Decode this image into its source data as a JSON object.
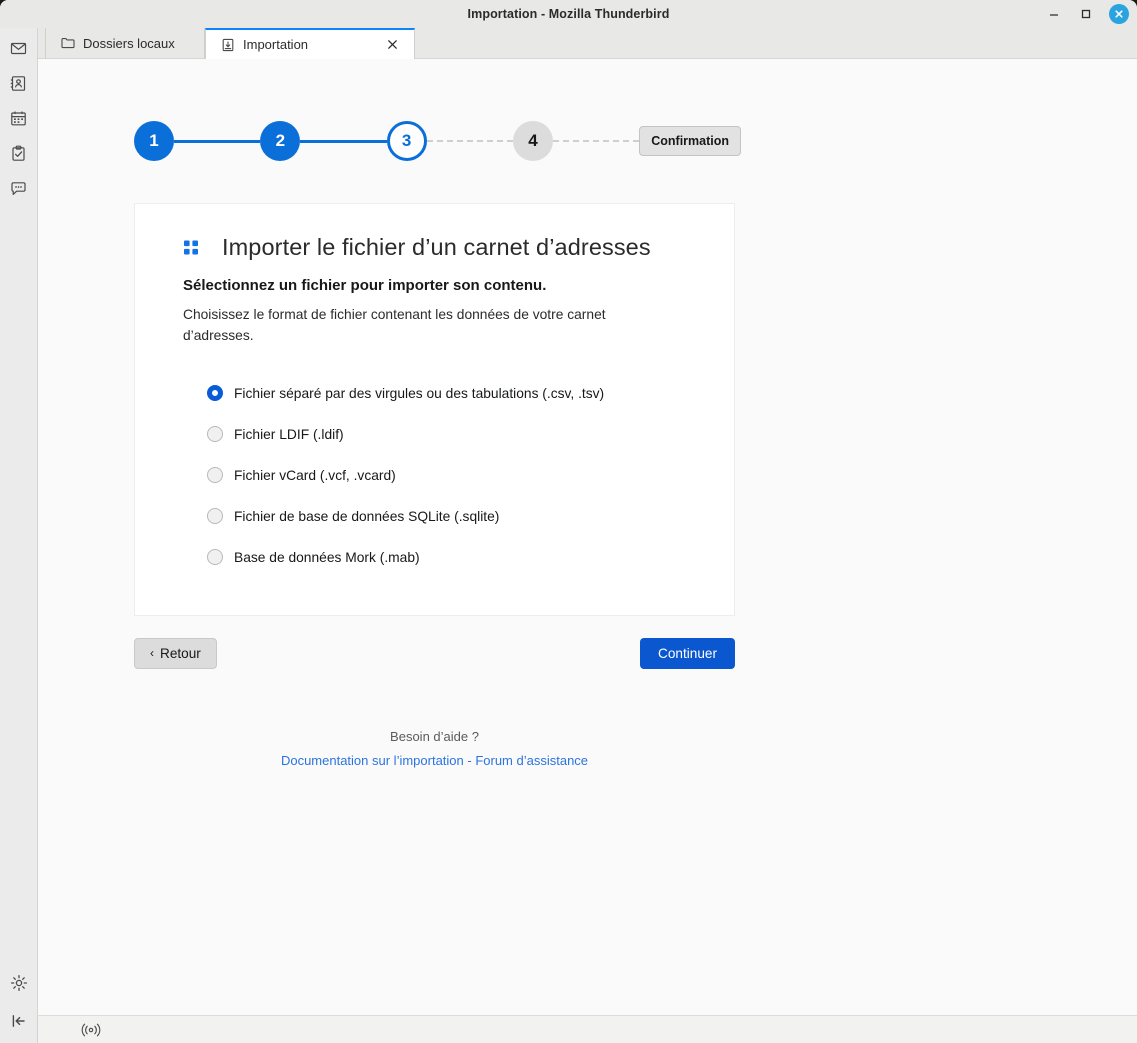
{
  "window": {
    "title": "Importation - Mozilla Thunderbird",
    "controls": {
      "minimize": "minimize-icon",
      "maximize": "maximize-icon",
      "close": "close-icon"
    }
  },
  "rail": {
    "items": [
      {
        "name": "mail-icon",
        "label": "Courrier"
      },
      {
        "name": "address-book-icon",
        "label": "Carnet d’adresses"
      },
      {
        "name": "calendar-icon",
        "label": "Agenda"
      },
      {
        "name": "tasks-icon",
        "label": "Tâches"
      },
      {
        "name": "chat-icon",
        "label": "Discussion"
      }
    ],
    "bottom": [
      {
        "name": "settings-gear-icon",
        "label": "Paramètres"
      },
      {
        "name": "collapse-rail-icon",
        "label": "Réduire"
      }
    ]
  },
  "tabs": [
    {
      "label": "Dossiers locaux",
      "icon": "folder-icon",
      "active": false
    },
    {
      "label": "Importation",
      "icon": "import-icon",
      "active": true,
      "close": "×"
    }
  ],
  "stepper": {
    "steps": [
      {
        "number": "1",
        "state": "done"
      },
      {
        "number": "2",
        "state": "done"
      },
      {
        "number": "3",
        "state": "current"
      },
      {
        "number": "4",
        "state": "todo"
      }
    ],
    "confirmation_label": "Confirmation"
  },
  "card": {
    "icon": "address-book-grid-icon",
    "title": "Importer le fichier d’un carnet d’adresses",
    "subtitle": "Sélectionnez un fichier pour importer son contenu.",
    "description": "Choisissez le format de fichier contenant les données de votre carnet d’adresses.",
    "options": [
      {
        "label": "Fichier séparé par des virgules ou des tabulations (.csv, .tsv)",
        "selected": true
      },
      {
        "label": "Fichier LDIF (.ldif)",
        "selected": false
      },
      {
        "label": "Fichier vCard (.vcf, .vcard)",
        "selected": false
      },
      {
        "label": "Fichier de base de données SQLite (.sqlite)",
        "selected": false
      },
      {
        "label": "Base de données Mork (.mab)",
        "selected": false
      }
    ]
  },
  "buttons": {
    "back": "Retour",
    "back_chevron": "‹",
    "continue": "Continuer"
  },
  "help": {
    "question": "Besoin d’aide ?",
    "link1": "Documentation sur l’importation",
    "separator": " - ",
    "link2": "Forum d’assistance"
  },
  "statusbar": {
    "sync_icon": "sync-activity-icon"
  },
  "colors": {
    "accent_blue": "#0a57d0",
    "step_blue": "#0a6fd8",
    "tab_active_border": "#0a84ff",
    "link_blue": "#2b74e0",
    "close_circle": "#2aa3e0",
    "card_bg": "#ffffff",
    "page_bg": "#fafafa",
    "chrome_bg": "#e8e8e7"
  }
}
